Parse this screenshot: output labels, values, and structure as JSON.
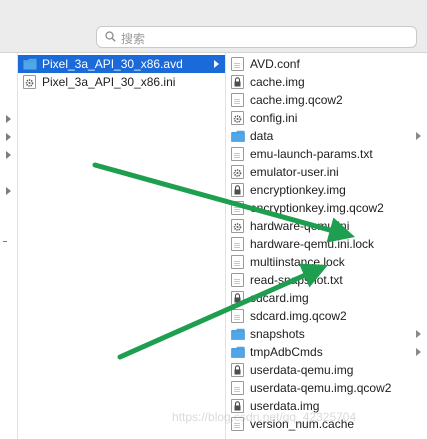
{
  "search": {
    "placeholder": "搜索"
  },
  "col2": {
    "items": [
      {
        "label": "Pixel_3a_API_30_x86.avd",
        "type": "folder",
        "selected": true
      },
      {
        "label": "Pixel_3a_API_30_x86.ini",
        "type": "config"
      }
    ]
  },
  "col3": {
    "items": [
      {
        "label": "AVD.conf",
        "type": "doc"
      },
      {
        "label": "cache.img",
        "type": "lock"
      },
      {
        "label": "cache.img.qcow2",
        "type": "doc"
      },
      {
        "label": "config.ini",
        "type": "config"
      },
      {
        "label": "data",
        "type": "folder"
      },
      {
        "label": "emu-launch-params.txt",
        "type": "doc"
      },
      {
        "label": "emulator-user.ini",
        "type": "config"
      },
      {
        "label": "encryptionkey.img",
        "type": "lock"
      },
      {
        "label": "encryptionkey.img.qcow2",
        "type": "doc"
      },
      {
        "label": "hardware-qemu.ini",
        "type": "config"
      },
      {
        "label": "hardware-qemu.ini.lock",
        "type": "doc"
      },
      {
        "label": "multiinstance.lock",
        "type": "doc"
      },
      {
        "label": "read-snapshot.txt",
        "type": "doc"
      },
      {
        "label": "sdcard.img",
        "type": "lock"
      },
      {
        "label": "sdcard.img.qcow2",
        "type": "doc"
      },
      {
        "label": "snapshots",
        "type": "folder"
      },
      {
        "label": "tmpAdbCmds",
        "type": "folder"
      },
      {
        "label": "userdata-qemu.img",
        "type": "lock"
      },
      {
        "label": "userdata-qemu.img.qcow2",
        "type": "doc"
      },
      {
        "label": "userdata.img",
        "type": "lock"
      },
      {
        "label": "version_num.cache",
        "type": "doc"
      }
    ]
  },
  "colors": {
    "selection": "#1b6ad9",
    "folder": "#4fa7ea",
    "arrow": "#1e9e4f"
  },
  "watermark": "https://blog.csdn.net/qq_42325704"
}
